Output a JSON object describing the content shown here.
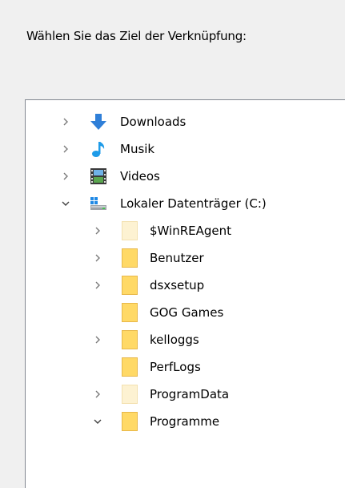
{
  "dialog": {
    "instruction": "Wählen Sie das Ziel der Verknüpfung:"
  },
  "tree": {
    "items": [
      {
        "label": "Downloads",
        "icon": "download-arrow-icon",
        "expander": "collapsed",
        "level": 1
      },
      {
        "label": "Musik",
        "icon": "music-note-icon",
        "expander": "collapsed",
        "level": 1
      },
      {
        "label": "Videos",
        "icon": "video-film-icon",
        "expander": "collapsed",
        "level": 1
      },
      {
        "label": "Lokaler Datenträger (C:)",
        "icon": "drive-icon",
        "expander": "expanded",
        "level": 1
      },
      {
        "label": "$WinREAgent",
        "icon": "folder-hidden-icon",
        "expander": "collapsed",
        "level": 2
      },
      {
        "label": "Benutzer",
        "icon": "folder-icon",
        "expander": "collapsed",
        "level": 2
      },
      {
        "label": "dsxsetup",
        "icon": "folder-icon",
        "expander": "collapsed",
        "level": 2
      },
      {
        "label": "GOG Games",
        "icon": "folder-icon",
        "expander": "none",
        "level": 2
      },
      {
        "label": "kelloggs",
        "icon": "folder-icon",
        "expander": "collapsed",
        "level": 2
      },
      {
        "label": "PerfLogs",
        "icon": "folder-icon",
        "expander": "none",
        "level": 2
      },
      {
        "label": "ProgramData",
        "icon": "folder-hidden-icon",
        "expander": "collapsed",
        "level": 2
      },
      {
        "label": "Programme",
        "icon": "folder-icon",
        "expander": "expanded",
        "level": 2
      }
    ]
  },
  "colors": {
    "folder": "#ffd966",
    "folder_hidden": "#fdf2d2",
    "downloads_arrow": "#2f7fd8",
    "music_note": "#1e9be8",
    "chevron": "#7a7a7a"
  }
}
